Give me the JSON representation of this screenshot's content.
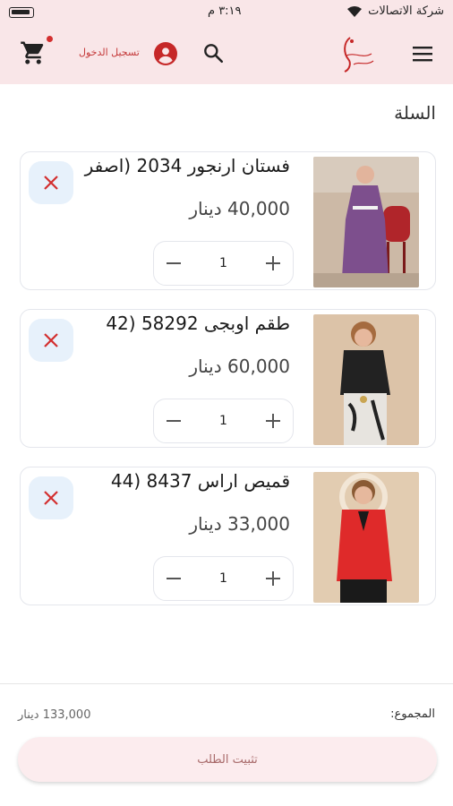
{
  "status_bar": {
    "time": "٣:١٩ م",
    "carrier": "شركة الاتصالات"
  },
  "header": {
    "login_label": "تسجيل الدخول",
    "cart_has_badge": true
  },
  "page": {
    "title": "السلة"
  },
  "cart": {
    "items": [
      {
        "name": "فستان ارنجور 2034 (اصفر",
        "price": "40,000 دينار",
        "quantity": "1"
      },
      {
        "name": "طقم اوبجى 58292 (42",
        "price": "60,000 دينار",
        "quantity": "1"
      },
      {
        "name": "قميص اراس 8437 (44",
        "price": "33,000 دينار",
        "quantity": "1"
      }
    ]
  },
  "summary": {
    "total_label": "المجموع:",
    "total_value": "133,000 دينار",
    "checkout_label": "تثبيت الطلب"
  },
  "colors": {
    "header_bg": "#f9e6e8",
    "accent_red": "#c53a3a",
    "remove_bg": "#e7f1fb",
    "checkout_bg": "#fcecee"
  }
}
